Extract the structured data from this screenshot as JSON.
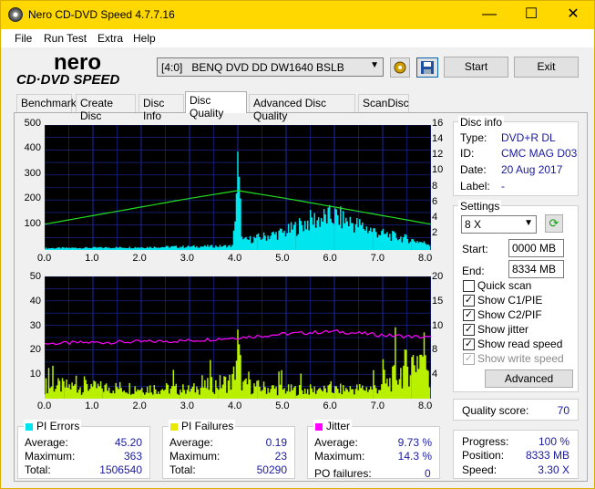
{
  "window": {
    "title": "Nero CD-DVD Speed 4.7.7.16",
    "minimize": "—",
    "maximize": "☐",
    "close": "✕"
  },
  "menu": [
    "File",
    "Run Test",
    "Extra",
    "Help"
  ],
  "toolbar": {
    "drive": "[4:0]   BENQ DVD DD DW1640 BSLB",
    "start_label": "Start",
    "exit_label": "Exit"
  },
  "logo": {
    "line1": "nero",
    "line2": "CD·DVD SPEED"
  },
  "tabs": [
    "Benchmark",
    "Create Disc",
    "Disc Info",
    "Disc Quality",
    "Advanced Disc Quality",
    "ScanDisc"
  ],
  "active_tab": "Disc Quality",
  "disc_info": {
    "title": "Disc info",
    "type_label": "Type:",
    "type": "DVD+R DL",
    "id_label": "ID:",
    "id": "CMC MAG D03",
    "date_label": "Date:",
    "date": "20 Aug 2017",
    "label_label": "Label:",
    "label": "-"
  },
  "settings": {
    "title": "Settings",
    "speed": "8 X",
    "start_label": "Start:",
    "start": "0000 MB",
    "end_label": "End:",
    "end": "8334 MB",
    "quick_scan": "Quick scan",
    "show_c1": "Show C1/PIE",
    "show_c2": "Show C2/PIF",
    "show_jitter": "Show jitter",
    "show_read": "Show read speed",
    "show_write": "Show write speed",
    "advanced": "Advanced"
  },
  "quality": {
    "label": "Quality score:",
    "value": "70"
  },
  "progress": {
    "progress_label": "Progress:",
    "progress": "100 %",
    "position_label": "Position:",
    "position": "8333 MB",
    "speed_label": "Speed:",
    "speed": "3.30 X"
  },
  "pi_errors": {
    "title": "PI Errors",
    "color": "#00e5ee",
    "avg_label": "Average:",
    "avg": "45.20",
    "max_label": "Maximum:",
    "max": "363",
    "total_label": "Total:",
    "total": "1506540"
  },
  "pi_failures": {
    "title": "PI Failures",
    "color": "#e8e800",
    "avg_label": "Average:",
    "avg": "0.19",
    "max_label": "Maximum:",
    "max": "23",
    "total_label": "Total:",
    "total": "50290"
  },
  "jitter": {
    "title": "Jitter",
    "color": "#ff00ff",
    "avg_label": "Average:",
    "avg": "9.73 %",
    "max_label": "Maximum:",
    "max": "14.3 %",
    "po_label": "PO failures:",
    "po": "0"
  },
  "chart1": {
    "y_left": [
      "500",
      "400",
      "300",
      "200",
      "100"
    ],
    "y_right": [
      "16",
      "14",
      "12",
      "10",
      "8",
      "6",
      "4",
      "2"
    ],
    "x": [
      "0.0",
      "1.0",
      "2.0",
      "3.0",
      "4.0",
      "5.0",
      "6.0",
      "7.0",
      "8.0"
    ]
  },
  "chart2": {
    "y_left": [
      "50",
      "40",
      "30",
      "20",
      "10"
    ],
    "y_right": [
      "20",
      "15",
      "10",
      "8",
      "4"
    ],
    "x": [
      "0.0",
      "1.0",
      "2.0",
      "3.0",
      "4.0",
      "5.0",
      "6.0",
      "7.0",
      "8.0"
    ]
  },
  "chart_data": [
    {
      "type": "area",
      "series": [
        {
          "name": "PI Errors",
          "x": [
            0,
            1,
            2,
            3,
            3.9,
            4.0,
            4.1,
            5,
            5.5,
            6,
            6.5,
            7,
            7.5,
            8
          ],
          "y": [
            8,
            10,
            12,
            15,
            18,
            360,
            40,
            80,
            130,
            150,
            110,
            70,
            50,
            25
          ]
        },
        {
          "name": "Read speed",
          "x": [
            0,
            1,
            2,
            3,
            4,
            5,
            6,
            7,
            8
          ],
          "y": [
            3.3,
            4.4,
            5.5,
            6.6,
            7.6,
            6.6,
            5.5,
            4.4,
            3.3
          ]
        }
      ],
      "ylim": [
        0,
        500
      ],
      "y2lim": [
        0,
        16
      ],
      "xlim": [
        0,
        8
      ]
    },
    {
      "type": "area",
      "series": [
        {
          "name": "PI Failures",
          "x": [
            0,
            1,
            2,
            3,
            3.9,
            4.0,
            4.1,
            5,
            6,
            7,
            7.9,
            8
          ],
          "y": [
            6,
            5,
            5,
            4,
            8,
            23,
            6,
            4,
            4,
            5,
            22,
            6
          ]
        },
        {
          "name": "Jitter",
          "x": [
            0,
            1,
            2,
            3,
            4,
            5,
            6,
            7,
            8
          ],
          "y": [
            9.0,
            9.2,
            9.3,
            9.5,
            10.0,
            10.6,
            11.0,
            10.4,
            10.0
          ]
        }
      ],
      "ylim": [
        0,
        50
      ],
      "y2lim": [
        0,
        20
      ],
      "xlim": [
        0,
        8
      ]
    }
  ]
}
